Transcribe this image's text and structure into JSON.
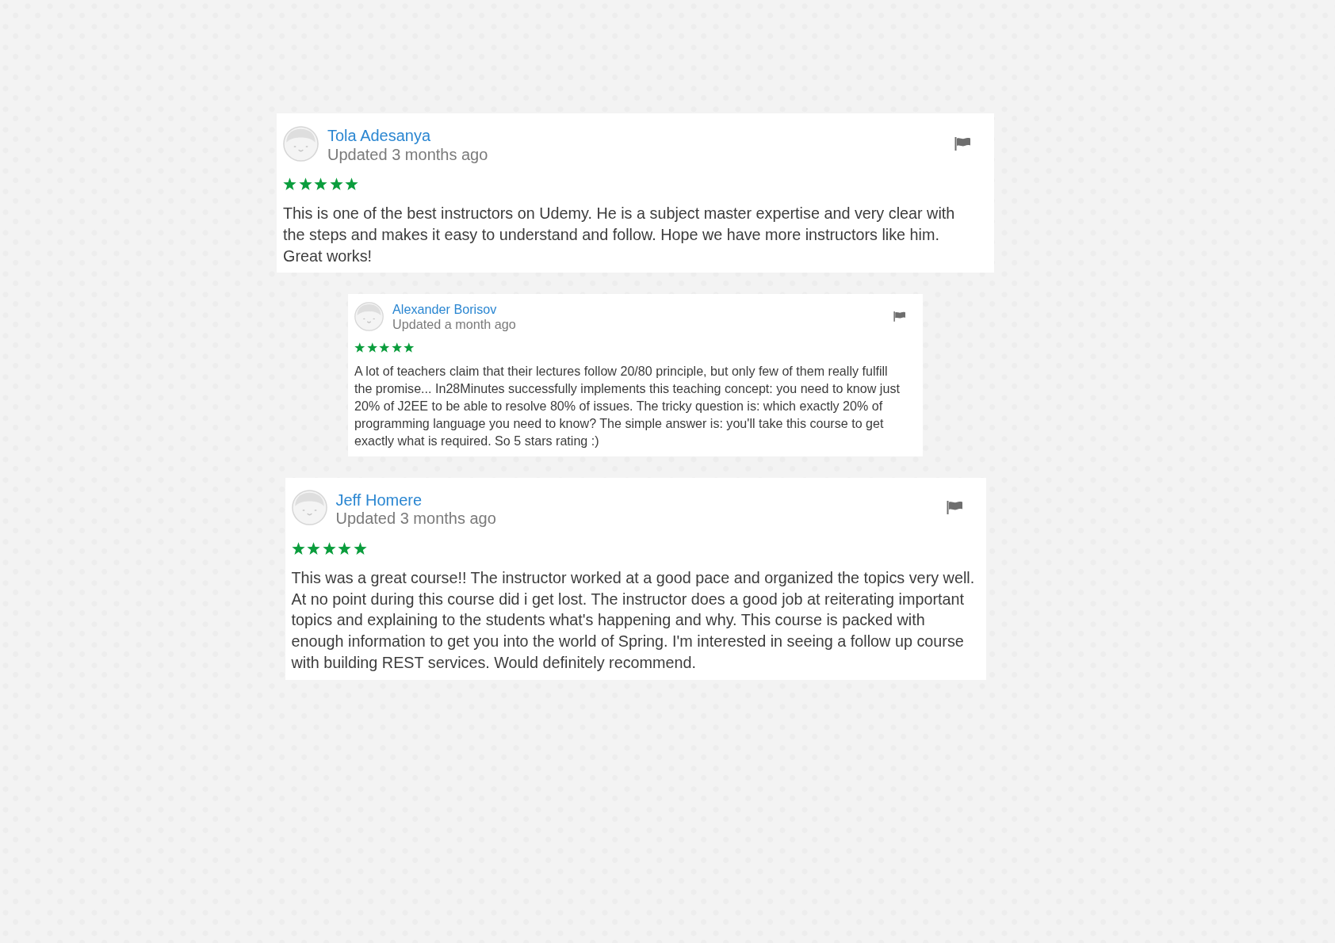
{
  "reviews": [
    {
      "kind": "regular",
      "name": "Tola Adesanya",
      "updated": "Updated 3 months ago",
      "stars": 5,
      "text": "This is one of the best instructors on Udemy. He is a subject master expertise and very clear with the steps and makes it easy to understand and follow. Hope we have more instructors like him. Great works!"
    },
    {
      "kind": "compact",
      "name": "Alexander Borisov",
      "updated": "Updated a month ago",
      "stars": 5,
      "text": "A lot of teachers claim that their lectures follow 20/80 principle, but only few of them really fulfill the promise... In28Minutes successfully implements this teaching concept: you need to know just 20% of J2EE to be able to resolve 80% of issues. The tricky question is: which exactly 20% of programming language you need to know? The simple answer is: you'll take this course to get exactly what is required. So 5 stars rating :)"
    },
    {
      "kind": "regular",
      "name": "Jeff Homere",
      "updated": "Updated 3 months ago",
      "stars": 5,
      "text": "This was a great course!! The instructor worked at a good pace and organized the topics very well. At no point during this course did i get lost. The instructor does a good job at reiterating important topics and explaining to the students what's happening and why. This course is packed with enough information to get you into the world of Spring. I'm interested in seeing a follow up course with building REST services. Would definitely recommend."
    }
  ]
}
